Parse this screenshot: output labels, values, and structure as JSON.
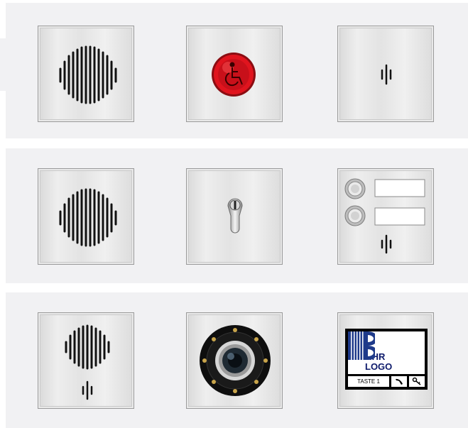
{
  "panel": {
    "rows": [
      {
        "tiles": [
          {
            "module": "speaker-grille",
            "icon": "speaker-grille-icon"
          },
          {
            "module": "accessible-call-button",
            "icon": "wheelchair-icon",
            "accent": "#e0141e"
          },
          {
            "module": "microphone",
            "icon": "microphone-icon"
          }
        ]
      },
      {
        "tiles": [
          {
            "module": "speaker-grille",
            "icon": "speaker-grille-icon"
          },
          {
            "module": "key-switch",
            "icon": "lock-cylinder-icon"
          },
          {
            "module": "two-button-bell-panel",
            "icon": "bell-button-icon",
            "buttons": 2
          }
        ]
      },
      {
        "tiles": [
          {
            "module": "speaker-with-microphone",
            "icon": "speaker-grille-icon"
          },
          {
            "module": "camera",
            "icon": "camera-lens-icon"
          },
          {
            "module": "logo-display",
            "icon": "logo-bars-icon",
            "brand_color": "#1e3a8a"
          }
        ]
      }
    ]
  },
  "logo_display": {
    "line1": "IHR",
    "line2": "LOGO",
    "key_label": "TASTE 1",
    "key2_icon": "handset-icon",
    "key3_icon": "key-icon"
  }
}
